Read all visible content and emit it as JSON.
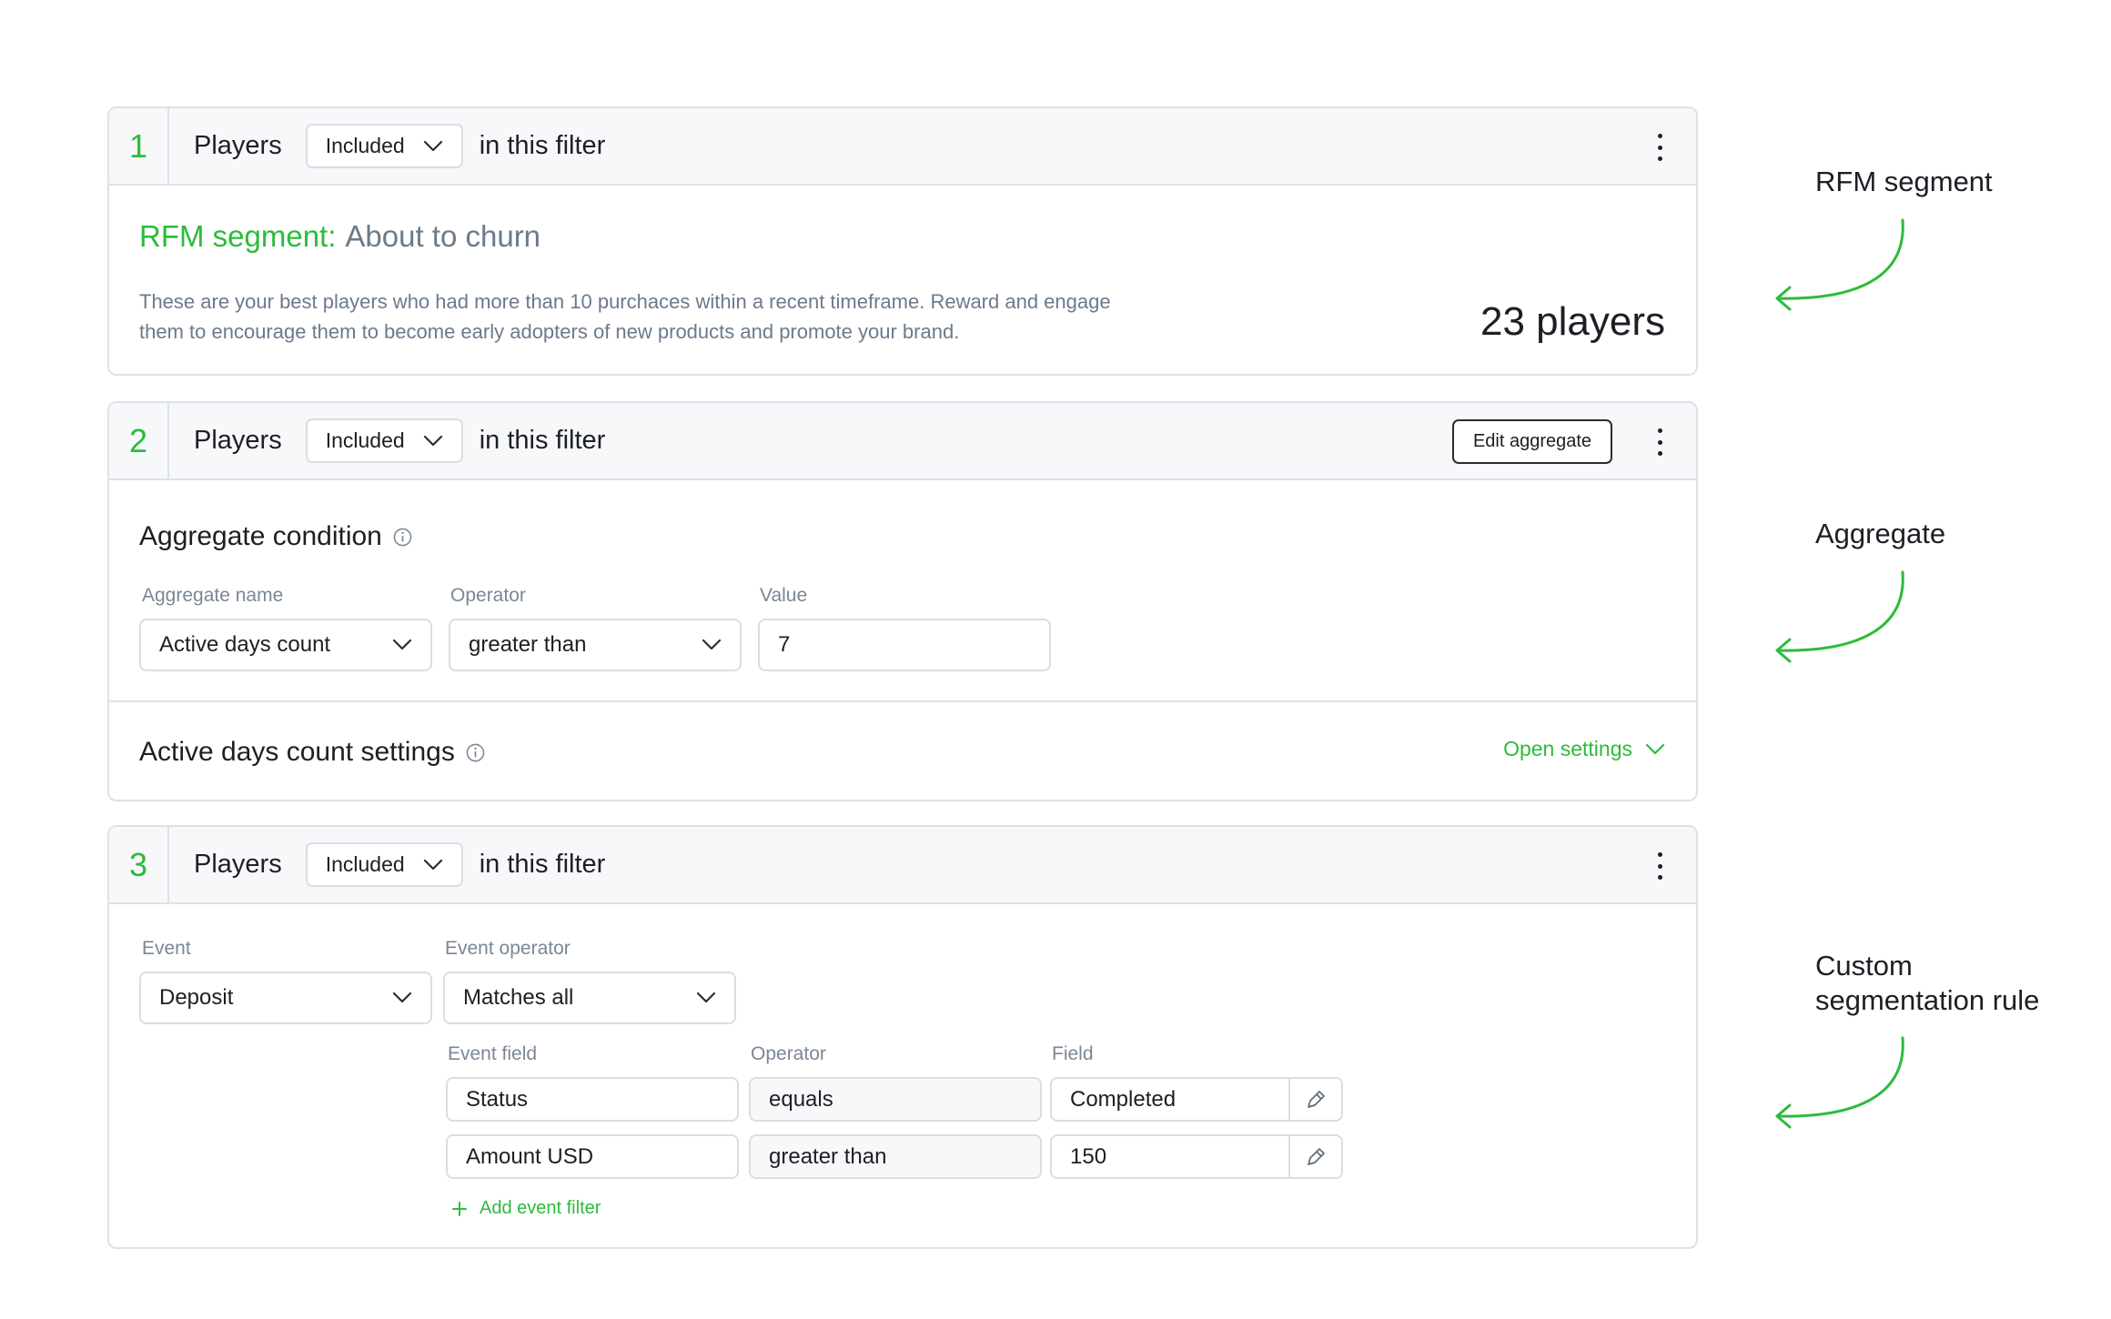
{
  "colors": {
    "accent": "#2dbb3c",
    "muted": "#6b7a8c",
    "border": "#dde2e8",
    "header_bg": "#f7f8fa"
  },
  "icons": {
    "kebab": "more-vertical-icon",
    "chevron": "chevron-down-icon",
    "info": "info-circle-icon",
    "picker": "pen-picker-icon",
    "plus": "plus-icon",
    "arrow": "curved-arrow-left-icon"
  },
  "filters": [
    {
      "step": "1",
      "subject": "Players",
      "inclusion": "Included",
      "suffix": "in this filter",
      "rfm_label": "RFM segment:",
      "rfm_value": "About to churn",
      "description": "These are your best players who had more than 10 purchaces within a recent timeframe. Reward and engage them to encourage them to become early adopters of new products and promote your brand.",
      "count": "23 players"
    },
    {
      "step": "2",
      "subject": "Players",
      "inclusion": "Included",
      "suffix": "in this filter",
      "edit_button": "Edit aggregate",
      "condition_title": "Aggregate condition",
      "aggregate_name_label": "Aggregate name",
      "aggregate_name_value": "Active days count",
      "operator_label": "Operator",
      "operator_value": "greater than",
      "value_label": "Value",
      "value_value": "7",
      "settings_title": "Active days count settings",
      "open_settings": "Open settings"
    },
    {
      "step": "3",
      "subject": "Players",
      "inclusion": "Included",
      "suffix": "in this filter",
      "event_label": "Event",
      "event_value": "Deposit",
      "event_operator_label": "Event operator",
      "event_operator_value": "Matches all",
      "col_event_field": "Event field",
      "col_operator": "Operator",
      "col_field": "Field",
      "rows": [
        {
          "event_field": "Status",
          "operator": "equals",
          "field": "Completed"
        },
        {
          "event_field": "Amount USD",
          "operator": "greater than",
          "field": "150"
        }
      ],
      "add_event_filter": "Add event filter"
    }
  ],
  "annotations": {
    "rfm": "RFM segment",
    "aggregate": "Aggregate",
    "custom_line1": "Custom",
    "custom_line2": "segmentation rule"
  }
}
